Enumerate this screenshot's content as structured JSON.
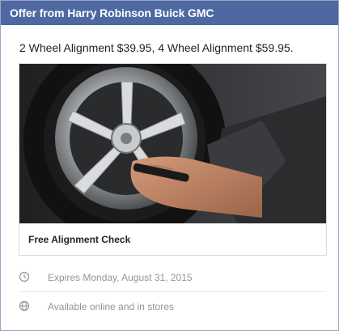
{
  "header": {
    "title": "Offer from Harry Robinson Buick GMC"
  },
  "offer": {
    "description": "2 Wheel Alignment $39.95, 4 Wheel Alignment $59.95."
  },
  "card": {
    "caption": "Free Alignment Check",
    "image_icon": "wheel-photo"
  },
  "details": {
    "expires": {
      "icon": "clock-icon",
      "text": "Expires Monday, August 31, 2015"
    },
    "availability": {
      "icon": "globe-icon",
      "text": "Available online and in stores"
    }
  },
  "colors": {
    "header_bg": "#4e69a2",
    "muted_text": "#90949c"
  }
}
